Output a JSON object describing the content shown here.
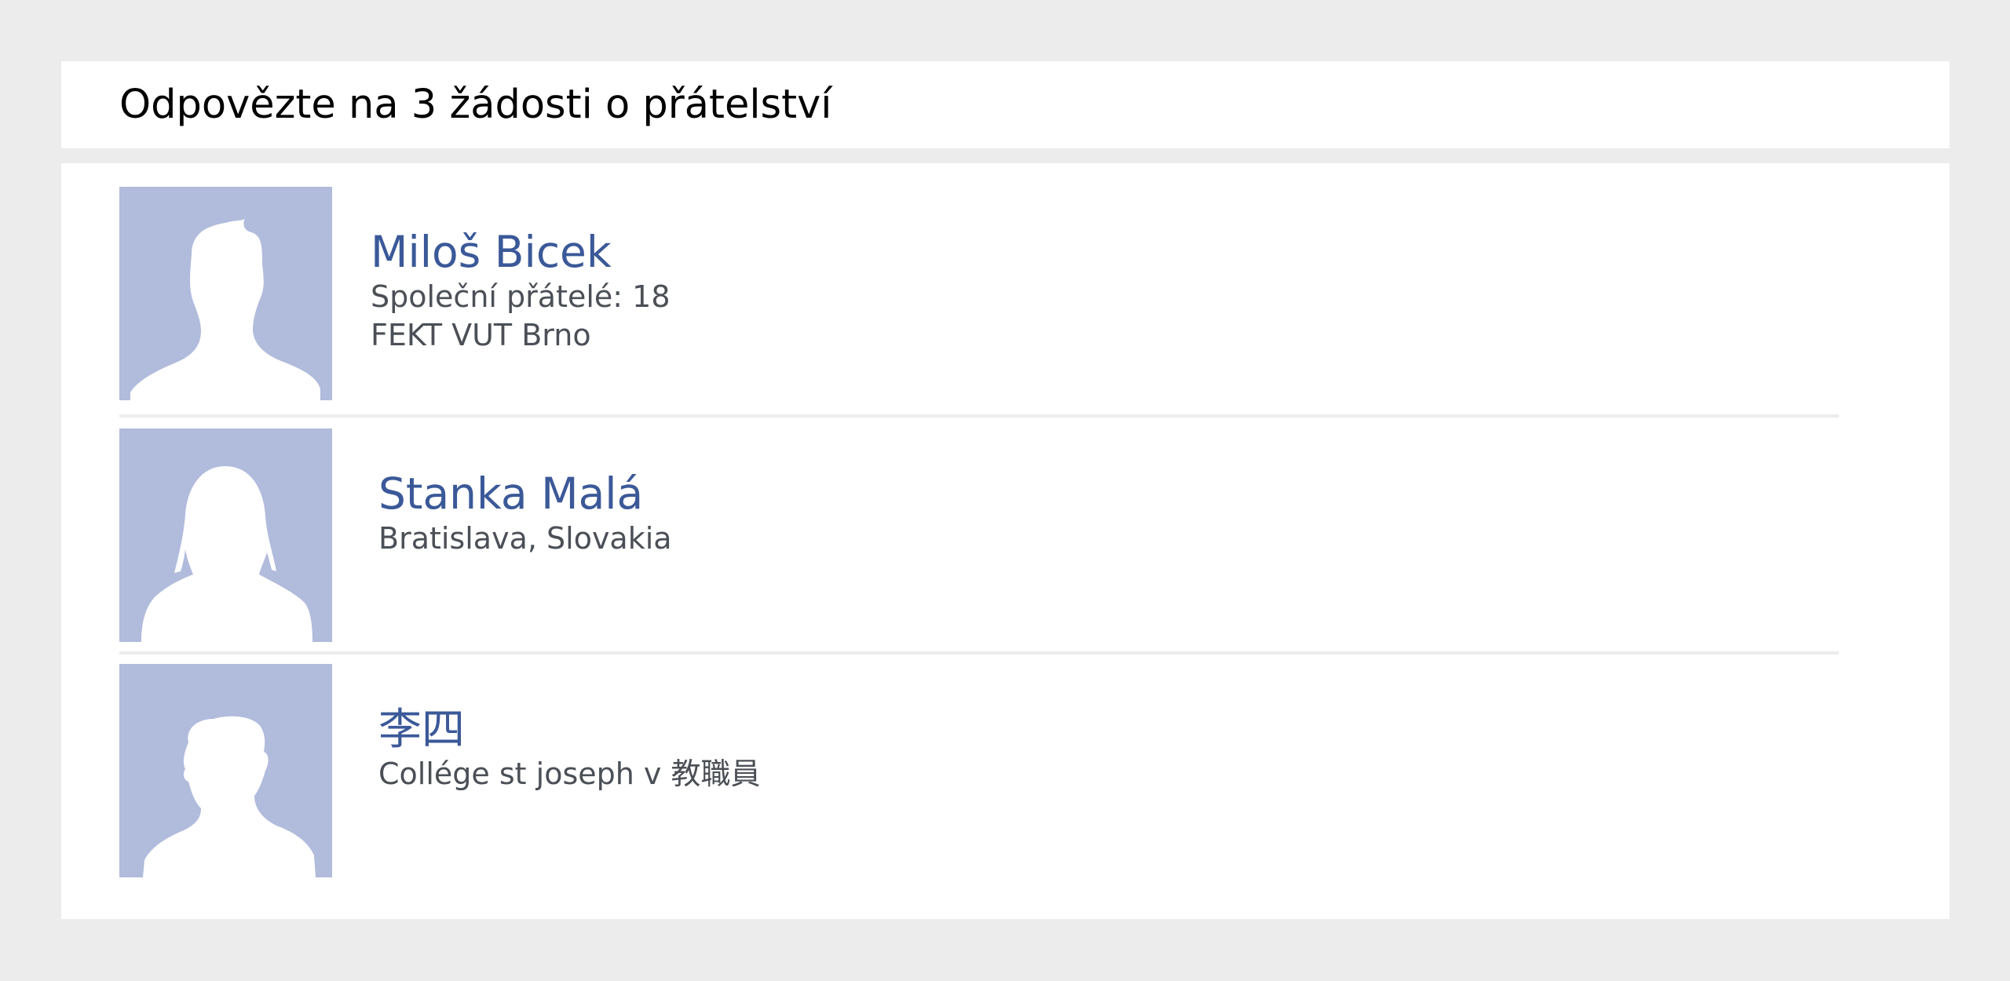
{
  "header": {
    "title": "Odpovězte na 3 žádosti o přátelství"
  },
  "requests": [
    {
      "name": "Miloš Bicek",
      "details": [
        "Společní přátelé: 18",
        "FEKT VUT Brno"
      ],
      "avatar_icon": "male-silhouette-icon"
    },
    {
      "name": "Stanka Malá",
      "details": [
        "Bratislava, Slovakia"
      ],
      "avatar_icon": "female-silhouette-icon"
    },
    {
      "name": "李四",
      "details": [
        "Collége st joseph v 教職員"
      ],
      "avatar_icon": "male-silhouette-icon"
    }
  ],
  "colors": {
    "page_background": "#ececec",
    "card_background": "#ffffff",
    "avatar_background": "#b1bbdc",
    "name_link": "#3b5998",
    "detail_text": "#4b4f56"
  }
}
